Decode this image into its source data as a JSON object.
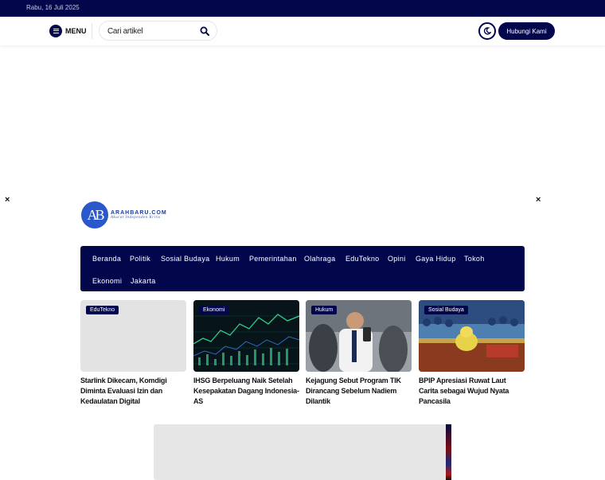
{
  "topbar": {
    "date": "Rabu, 16 Juli 2025"
  },
  "header": {
    "menu_label": "MENU",
    "search_placeholder": "Cari artikel",
    "contact_label": "Hubungi Kami"
  },
  "popup": {
    "close_glyph": "×"
  },
  "logo": {
    "badge": "AB",
    "name": "ARAHBARU.COM",
    "tagline": "Akurat Independen Kritis"
  },
  "nav": {
    "items": [
      "Beranda",
      "Politik",
      "Sosial Budaya",
      "Hukum",
      "Pemerintahan",
      "Olahraga",
      "EduTekno",
      "Opini",
      "Gaya Hidup",
      "Tokoh",
      "Ekonomi",
      "Jakarta"
    ]
  },
  "cards": [
    {
      "tag": "EduTekno",
      "title": "Starlink Dikecam, Komdigi Diminta Evaluasi Izin dan Kedaulatan Digital"
    },
    {
      "tag": "Ekonomi",
      "title": "IHSG Berpeluang Naik Setelah Kesepakatan Dagang Indonesia-AS"
    },
    {
      "tag": "Hukum",
      "title": "Kejagung Sebut Program TIK Dirancang Sebelum Nadiem Dilantik"
    },
    {
      "tag": "Sosial Budaya",
      "title": "BPIP Apresiasi Ruwat Laut Carita sebagai Wujud Nyata Pancasila"
    }
  ],
  "colors": {
    "brand": "#02064a",
    "logo_blue": "#2a57c9"
  },
  "icons": {
    "menu": "hamburger-icon",
    "search": "search-icon",
    "dark_mode": "moon-icon",
    "close": "close-icon"
  }
}
